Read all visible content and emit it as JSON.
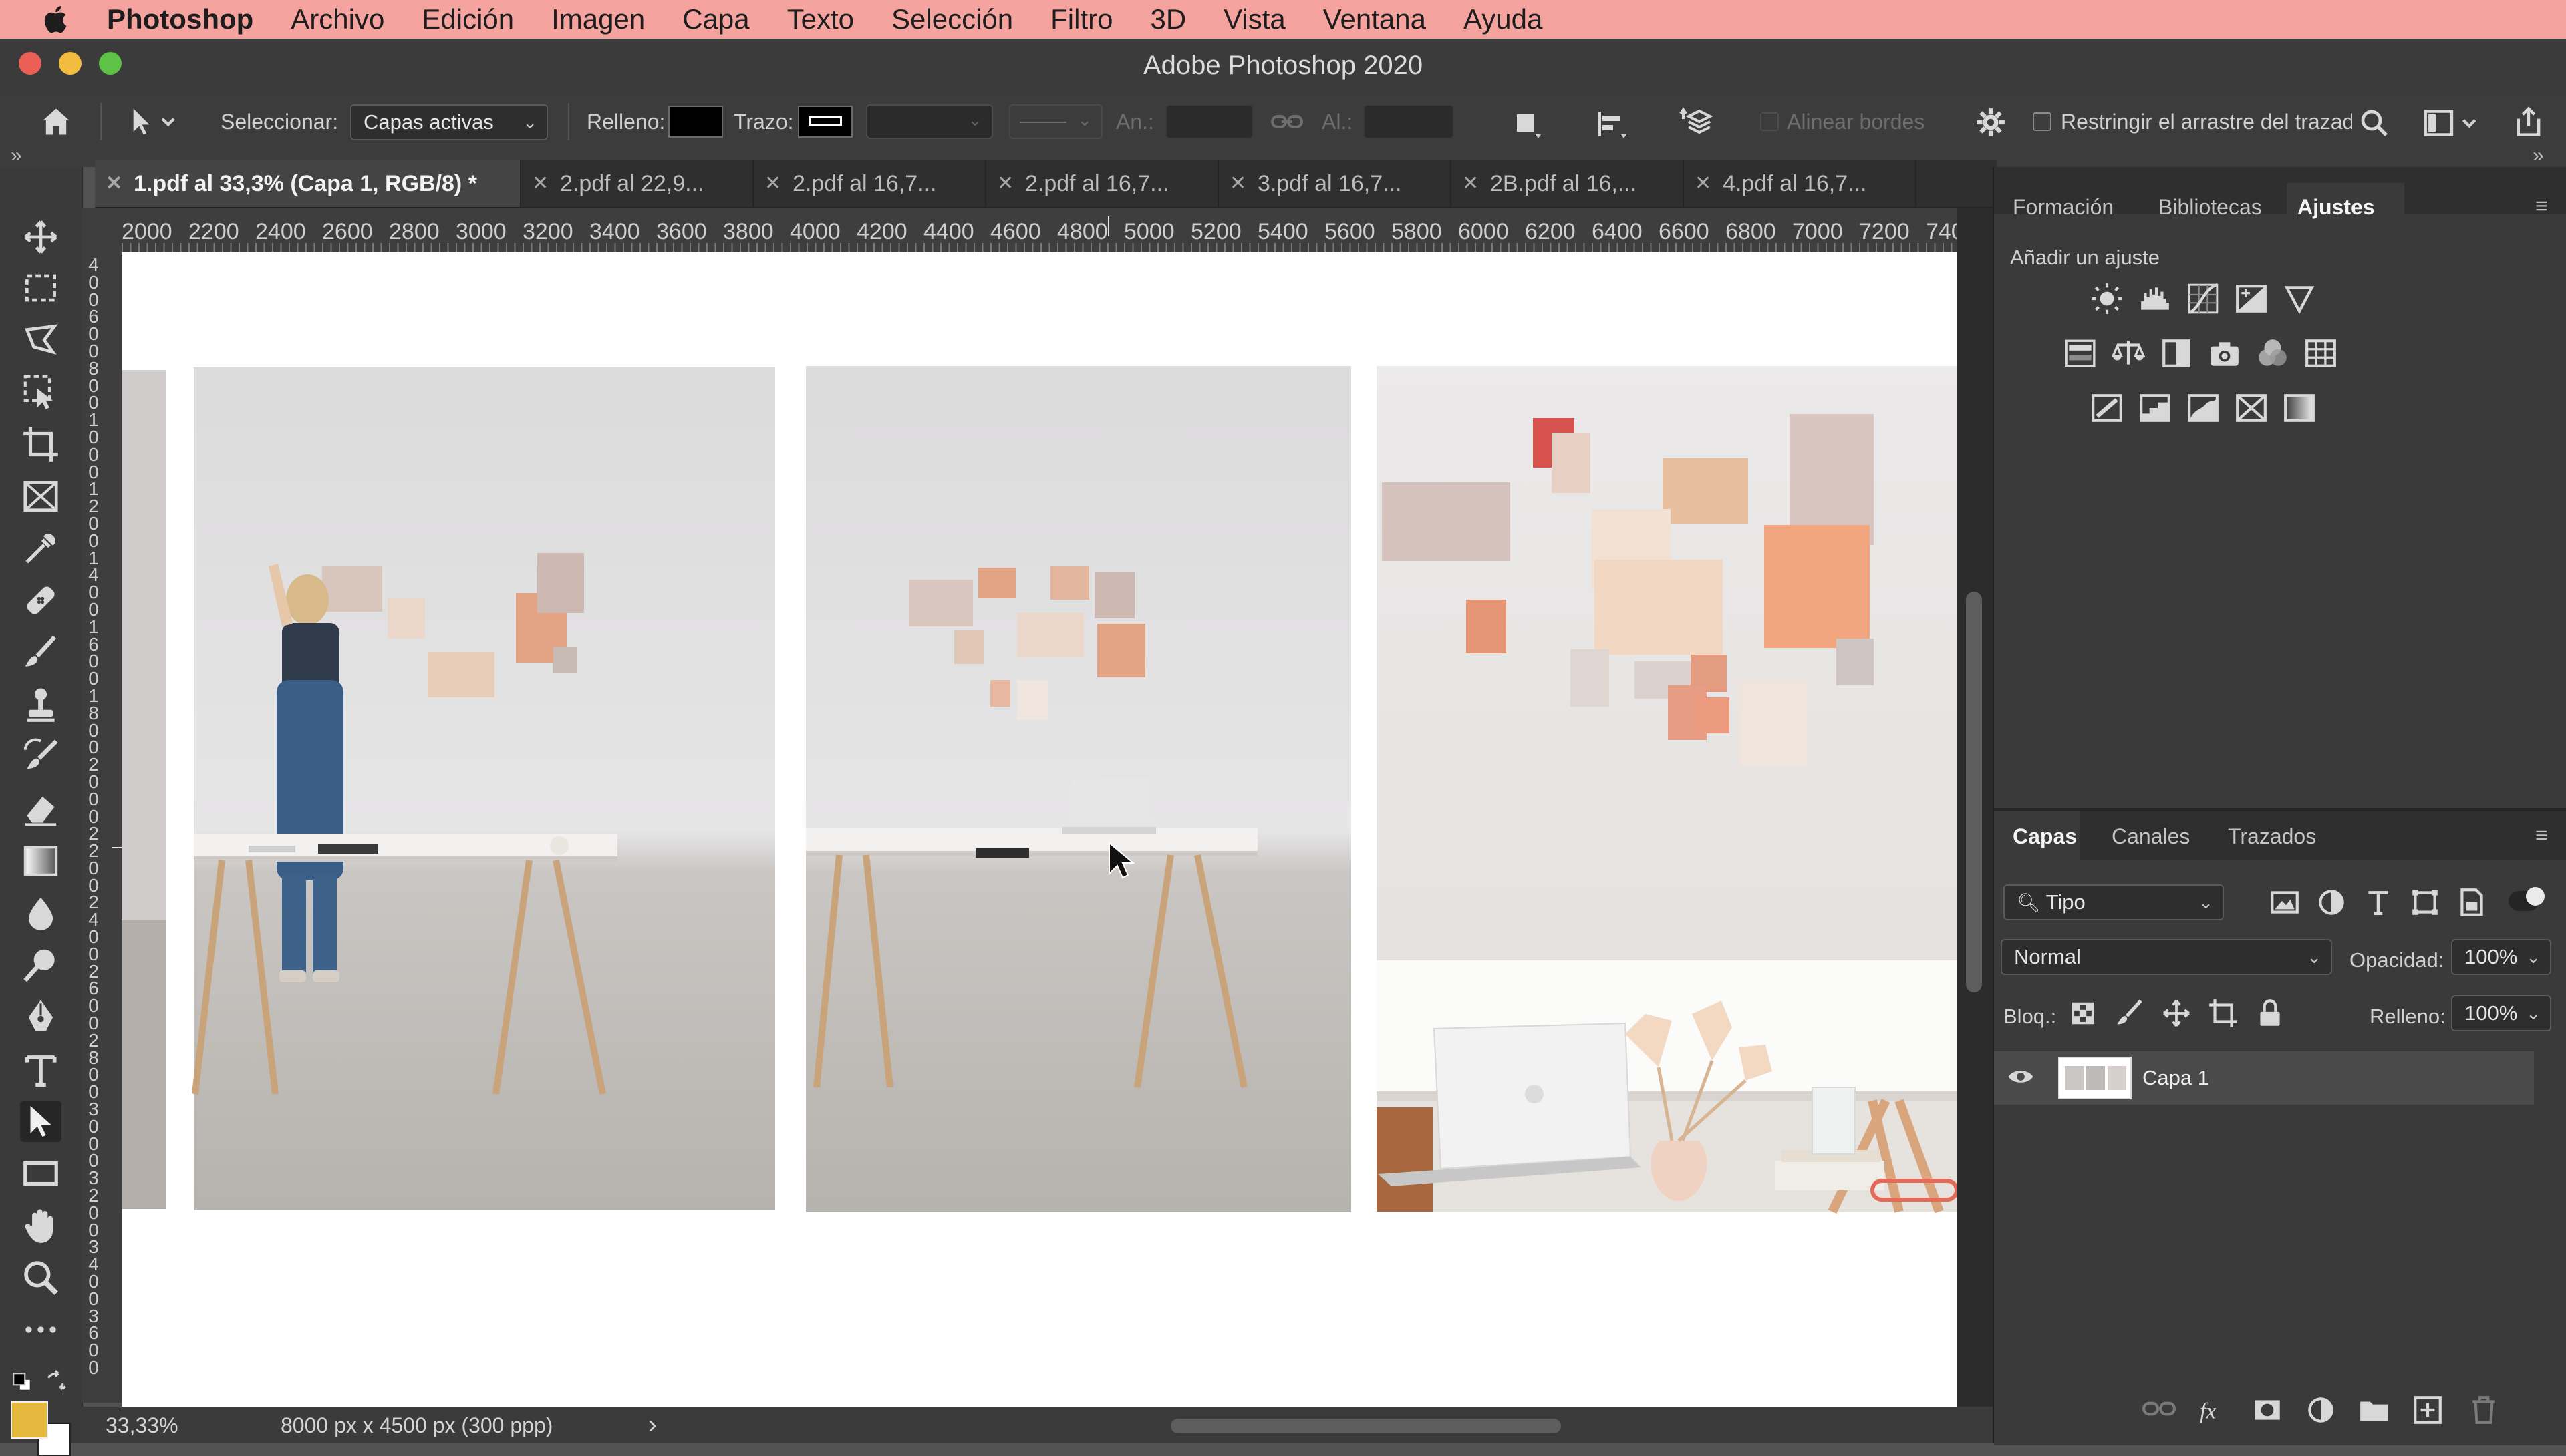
{
  "menubar": {
    "app": "Photoshop",
    "items": [
      "Archivo",
      "Edición",
      "Imagen",
      "Capa",
      "Texto",
      "Selección",
      "Filtro",
      "3D",
      "Vista",
      "Ventana",
      "Ayuda"
    ]
  },
  "window": {
    "title": "Adobe Photoshop 2020"
  },
  "options": {
    "select_label": "Seleccionar:",
    "select_value": "Capas activas",
    "fill_label": "Relleno:",
    "stroke_label": "Trazo:",
    "width_label": "An.:",
    "height_label": "Al.:",
    "align_edges": "Alinear bordes",
    "constrain_label": "Restringir el arrastre del trazado"
  },
  "tabs": [
    {
      "label": "1.pdf al 33,3% (Capa 1, RGB/8) *",
      "active": true
    },
    {
      "label": "2.pdf al 22,9..."
    },
    {
      "label": "2.pdf al 16,7..."
    },
    {
      "label": "2.pdf al 16,7..."
    },
    {
      "label": "3.pdf al 16,7..."
    },
    {
      "label": "2B.pdf al 16,..."
    },
    {
      "label": "4.pdf al 16,7..."
    }
  ],
  "ruler": {
    "h_ticks": [
      "2000",
      "2200",
      "2400",
      "2600",
      "2800",
      "3000",
      "3200",
      "3400",
      "3600",
      "3800",
      "4000",
      "4200",
      "4400",
      "4600",
      "4800",
      "5000",
      "5200",
      "5400",
      "5600",
      "5800",
      "6000",
      "6200",
      "6400",
      "6600",
      "6800",
      "7000",
      "7200",
      "740"
    ],
    "v_ticks": [
      "4",
      "0",
      "0",
      "6",
      "0",
      "0",
      "8",
      "0",
      "0",
      "1",
      "0",
      "0",
      "0",
      "1",
      "2",
      "0",
      "0",
      "1",
      "4",
      "0",
      "0",
      "1",
      "6",
      "0",
      "0",
      "1",
      "8",
      "0",
      "0",
      "2",
      "0",
      "0",
      "0",
      "2",
      "2",
      "0",
      "0",
      "2",
      "4",
      "0",
      "0",
      "2",
      "6",
      "0",
      "0",
      "2",
      "8",
      "0",
      "0",
      "3",
      "0",
      "0",
      "0",
      "3",
      "2",
      "0",
      "0",
      "3",
      "4",
      "0",
      "0",
      "3",
      "6",
      "0",
      "0"
    ]
  },
  "status": {
    "zoom": "33,33%",
    "doc_size": "8000 px x 4500 px (300 ppp)",
    "arrow": "›"
  },
  "top_panel": {
    "tabs": [
      "Formación",
      "Bibliotecas",
      "Ajustes"
    ],
    "active": "Ajustes",
    "add_adjustment": "Añadir un ajuste"
  },
  "layers_panel": {
    "tabs": [
      "Capas",
      "Canales",
      "Trazados"
    ],
    "active": "Capas",
    "filter_kind": "Tipo",
    "blend_mode": "Normal",
    "opacity_label": "Opacidad:",
    "opacity_value": "100%",
    "lock_label": "Bloq.:",
    "fill_label": "Relleno:",
    "fill_value": "100%",
    "layer_name": "Capa 1"
  },
  "colors": {
    "menubar_bg": "#f4a39f",
    "foreground_swatch": "#e3b83c",
    "brand_logo": "#c8102e"
  }
}
